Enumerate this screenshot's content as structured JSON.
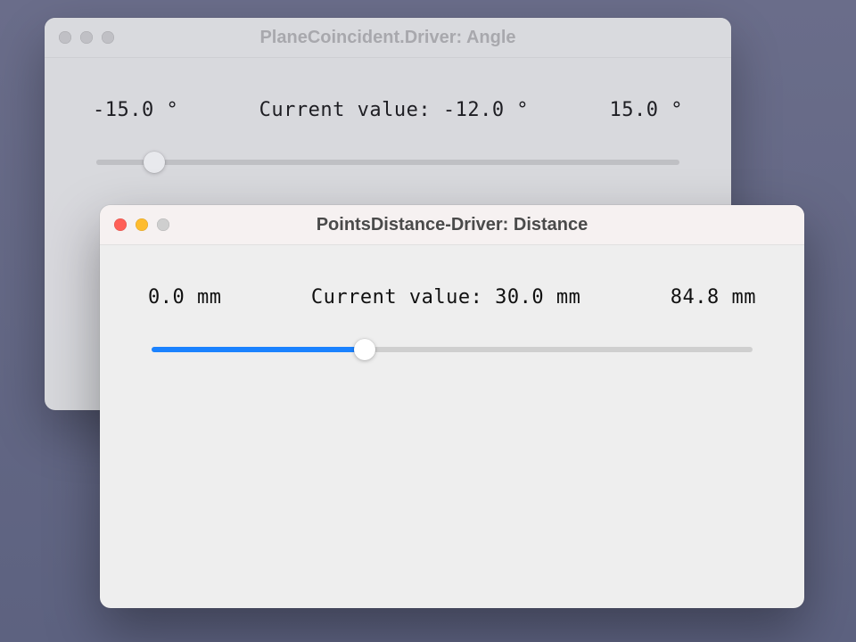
{
  "windows": {
    "angle": {
      "title": "PlaneCoincident.Driver: Angle",
      "min_label": "-15.0 °",
      "current_label": "Current value: -12.0 °",
      "max_label": "15.0 °",
      "slider_percent": 10
    },
    "distance": {
      "title": "PointsDistance-Driver: Distance",
      "min_label": "0.0 mm",
      "current_label": "Current value: 30.0 mm",
      "max_label": "84.8 mm",
      "slider_percent": 35.4
    }
  }
}
